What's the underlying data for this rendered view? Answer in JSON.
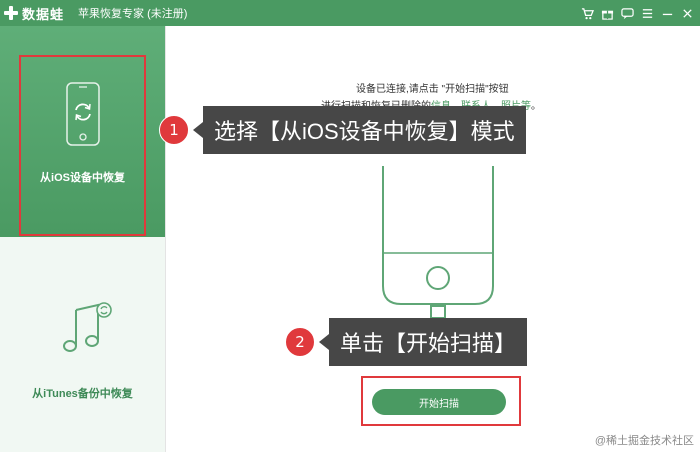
{
  "titlebar": {
    "logo_text": "数据蛙",
    "app_title": "苹果恢复专家 (未注册)",
    "icons": [
      "cart-icon",
      "gift-icon",
      "chat-icon",
      "menu-icon",
      "minimize-icon",
      "close-icon"
    ]
  },
  "sidebar": {
    "items": [
      {
        "label": "从iOS设备中恢复",
        "icon": "phone-restore-icon",
        "selected": true
      },
      {
        "label": "从iTunes备份中恢复",
        "icon": "music-restore-icon",
        "selected": false
      }
    ]
  },
  "main": {
    "message_line1": "设备已连接,请点击 \"开始扫描\"按钮",
    "message_line2_prefix": "进行扫描和恢复已删除的",
    "message_link1": "信息",
    "message_sep": "、",
    "message_link2": "联系人",
    "message_link3": "照片等",
    "message_suffix": "。",
    "device_name": "iPhone",
    "scan_button": "开始扫描"
  },
  "callouts": [
    {
      "number": "1",
      "text": "选择【从iOS设备中恢复】模式"
    },
    {
      "number": "2",
      "text": "单击【开始扫描】"
    }
  ],
  "watermark": "@稀土掘金技术社区",
  "colors": {
    "brand": "#4a9a62",
    "highlight": "#e0393c",
    "callout_bg": "#474747"
  }
}
